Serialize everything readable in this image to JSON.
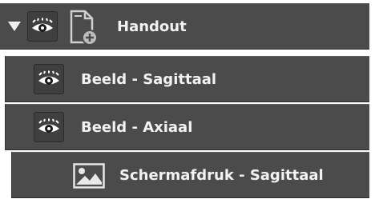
{
  "layers": [
    {
      "label": "Handout",
      "expanded": true,
      "icon": "document-add-icon",
      "visibility_icon": "eye-icon"
    },
    {
      "label": "Beeld - Sagittaal",
      "visibility_icon": "eye-icon"
    },
    {
      "label": "Beeld - Axiaal",
      "visibility_icon": "eye-icon"
    },
    {
      "label": "Schermafdruk - Sagittaal",
      "icon": "image-icon"
    }
  ],
  "colors": {
    "row_background": "#4b4b4b",
    "text": "#f2f2f2"
  }
}
